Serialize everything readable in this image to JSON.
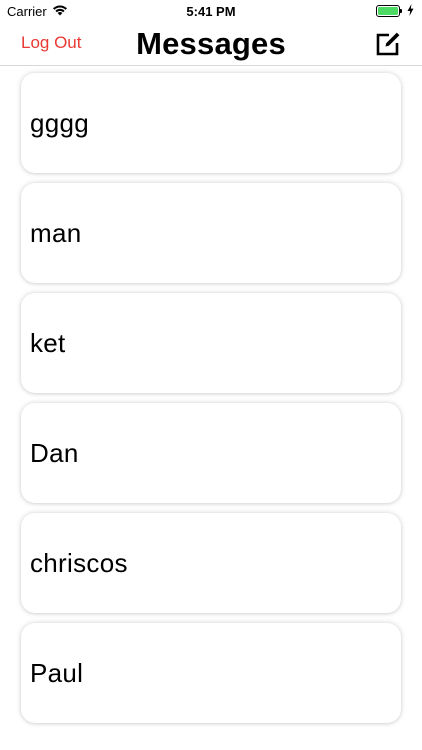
{
  "status_bar": {
    "carrier": "Carrier",
    "time": "5:41 PM",
    "battery_color": "#4cd964"
  },
  "nav": {
    "logout_label": "Log Out",
    "title": "Messages",
    "compose_icon": "compose-icon",
    "accent_color": "#e83a33"
  },
  "conversations": [
    {
      "name": "gggg"
    },
    {
      "name": "man"
    },
    {
      "name": "ket"
    },
    {
      "name": "Dan"
    },
    {
      "name": "chriscos"
    },
    {
      "name": "Paul"
    }
  ]
}
